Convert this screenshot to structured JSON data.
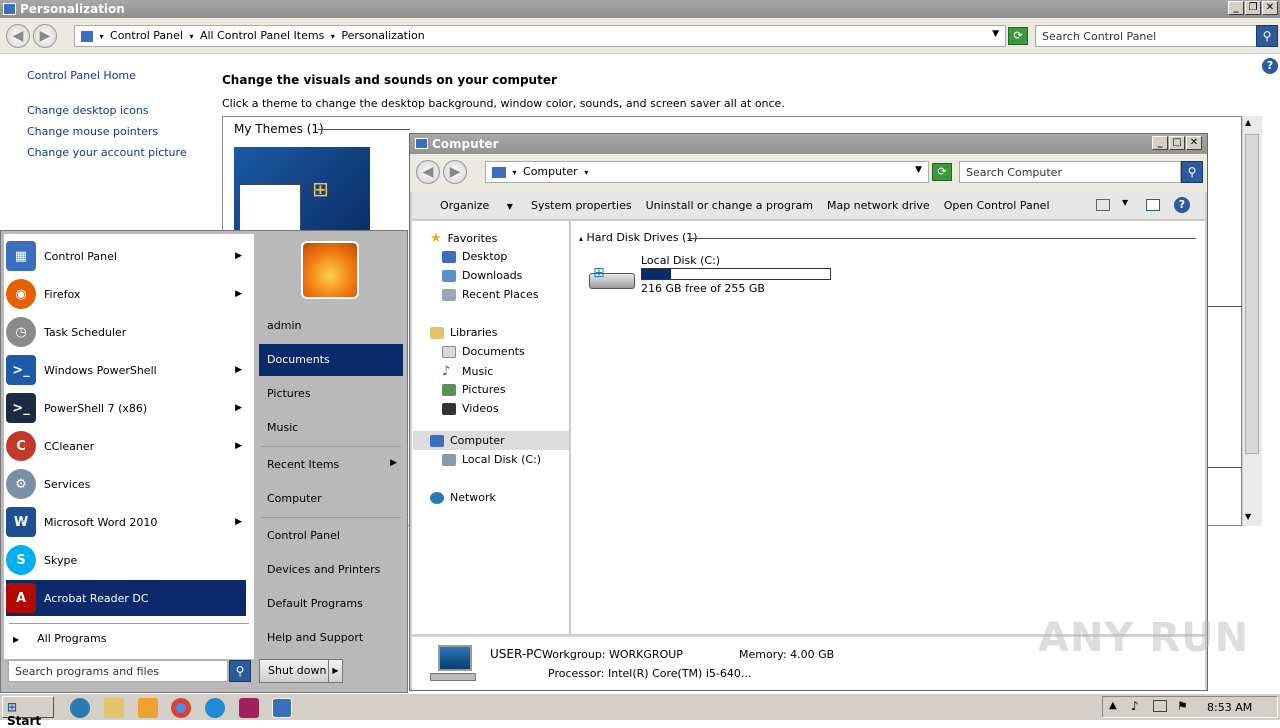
{
  "personalization": {
    "title": "Personalization",
    "breadcrumb": [
      "Control Panel",
      "All Control Panel Items",
      "Personalization"
    ],
    "search_placeholder": "Search Control Panel",
    "sidebar_links": [
      "Control Panel Home",
      "Change desktop icons",
      "Change mouse pointers",
      "Change your account picture"
    ],
    "heading": "Change the visuals and sounds on your computer",
    "subheading": "Click a theme to change the desktop background, window color, sounds, and screen saver all at once.",
    "my_themes_label": "My Themes (1)"
  },
  "start_menu": {
    "left_items": [
      {
        "label": "Control Panel",
        "icon": "control-panel-icon",
        "color": "#3a6fbf",
        "arrow": true
      },
      {
        "label": "Firefox",
        "icon": "firefox-icon",
        "color": "#e66000",
        "arrow": true
      },
      {
        "label": "Task Scheduler",
        "icon": "clock-icon",
        "color": "#8a8a8a",
        "arrow": false
      },
      {
        "label": "Windows PowerShell",
        "icon": "powershell-icon",
        "color": "#1e5aa8",
        "arrow": true
      },
      {
        "label": "PowerShell 7 (x86)",
        "icon": "powershell7-icon",
        "color": "#1c2b44",
        "arrow": true
      },
      {
        "label": "CCleaner",
        "icon": "ccleaner-icon",
        "color": "#c0392b",
        "arrow": true
      },
      {
        "label": "Services",
        "icon": "services-gear-icon",
        "color": "#7a8fa6",
        "arrow": false
      },
      {
        "label": "Microsoft Word 2010",
        "icon": "word-icon",
        "color": "#1d4f91",
        "arrow": true
      },
      {
        "label": "Skype",
        "icon": "skype-icon",
        "color": "#00aff0",
        "arrow": false
      },
      {
        "label": "Acrobat Reader DC",
        "icon": "acrobat-icon",
        "color": "#b30b00",
        "arrow": false
      }
    ],
    "all_programs": "All Programs",
    "search_placeholder": "Search programs and files",
    "right_items": [
      "admin",
      "Documents",
      "Pictures",
      "Music",
      "Recent Items",
      "Computer",
      "Control Panel",
      "Devices and Printers",
      "Default Programs",
      "Help and Support"
    ],
    "shutdown": "Shut down"
  },
  "computer": {
    "title": "Computer",
    "address": "Computer",
    "search_placeholder": "Search Computer",
    "toolbar": [
      "Organize",
      "System properties",
      "Uninstall or change a program",
      "Map network drive",
      "Open Control Panel"
    ],
    "nav": {
      "favorites": "Favorites",
      "favorites_items": [
        "Desktop",
        "Downloads",
        "Recent Places"
      ],
      "libraries": "Libraries",
      "libraries_items": [
        "Documents",
        "Music",
        "Pictures",
        "Videos"
      ],
      "computer": "Computer",
      "computer_items": [
        "Local Disk (C:)"
      ],
      "network": "Network"
    },
    "group_header": "Hard Disk Drives (1)",
    "drive": {
      "name": "Local Disk (C:)",
      "free_text": "216 GB free of 255 GB",
      "used_fraction": 0.153
    },
    "details": {
      "name": "USER-PC",
      "workgroup": "Workgroup: WORKGROUP",
      "memory": "Memory: 4.00 GB",
      "processor": "Processor: Intel(R) Core(TM) i5-640..."
    }
  },
  "taskbar": {
    "start": "Start",
    "time": "8:53 AM"
  },
  "watermark": "ANY RUN"
}
